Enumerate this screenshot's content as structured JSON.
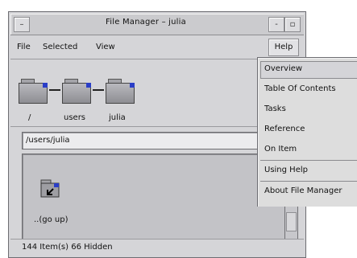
{
  "window": {
    "title": "File Manager – julia",
    "minimize_glyph": "–",
    "restore_glyph": "-",
    "maximize_glyph": "▫"
  },
  "menubar": {
    "file": "File",
    "selected": "Selected",
    "view": "View",
    "help": "Help"
  },
  "path_icons": [
    {
      "label": "/",
      "icon": "folder-icon"
    },
    {
      "label": "users",
      "icon": "folder-icon"
    },
    {
      "label": "julia",
      "icon": "folder-icon"
    }
  ],
  "path_field": {
    "value": "/users/julia"
  },
  "content": {
    "items": [
      {
        "label": "..(go up)",
        "icon": "go-up-folder-icon"
      }
    ]
  },
  "status": {
    "text": "144 Item(s) 66 Hidden"
  },
  "help_menu": {
    "items": [
      {
        "label": "Overview",
        "selected": true
      },
      {
        "label": "Table Of Contents"
      },
      {
        "label": "Tasks"
      },
      {
        "label": "Reference"
      },
      {
        "label": "On Item"
      },
      {
        "label": "Using Help"
      },
      {
        "label": "About File Manager"
      }
    ]
  },
  "colors": {
    "folder_accent": "#2a3ec7",
    "window_bg": "#d5d5d8"
  }
}
